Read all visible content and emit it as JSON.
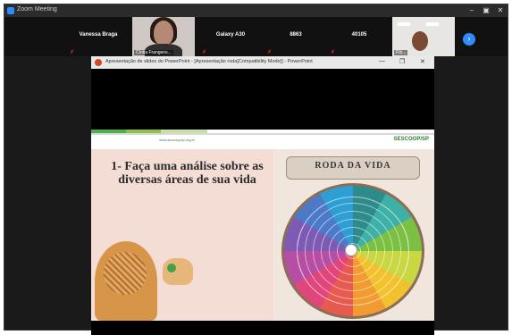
{
  "window": {
    "title": "Zoom Meeting",
    "controls": {
      "minimize": "–",
      "maximize": "▣",
      "close": "✕"
    }
  },
  "participants": [
    {
      "name": "Vanessa Braga",
      "muted": true,
      "video": false
    },
    {
      "name": "Cíntia Frangens...",
      "muted": true,
      "video": true
    },
    {
      "name": "Galaxy A30",
      "muted": true,
      "video": false
    },
    {
      "name": "8863",
      "muted": true,
      "video": false
    },
    {
      "name": "40105",
      "muted": true,
      "video": false
    },
    {
      "name": "Fíb...",
      "muted": false,
      "video": true
    }
  ],
  "next_page_icon": "chevron-right-icon",
  "presentation": {
    "window_title": "Apresentação de slides do PowerPoint - [Apresentação roda[Compatibility Mode]] - PowerPoint",
    "controls": {
      "minimize": "—",
      "restore": "❐",
      "close": "✕"
    }
  },
  "slide": {
    "url": "www.sescoopsp.org.br",
    "logo": "SESCOOP/SP",
    "heading": "1- Faça uma análise sobre as diversas áreas de sua vida",
    "wheel_title": "RODA DA VIDA"
  },
  "colors": {
    "zoom_blue": "#2d8cff",
    "mute_red": "#e53935",
    "slide_pink": "#f3ddd5",
    "logo_green": "#2e7d32"
  }
}
